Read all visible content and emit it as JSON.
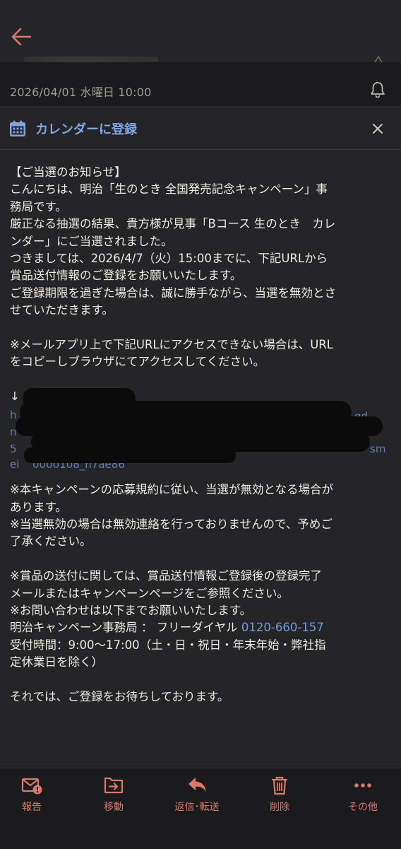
{
  "header": {
    "date": "2026/04/01 水曜日 10:00"
  },
  "calendar_bar": {
    "label": "カレンダーに登録"
  },
  "email": {
    "lines": [
      "【ご当選のお知らせ】",
      "こんにちは、明治「生のとき 全国発売記念キャンペーン」事",
      "務局です。",
      "厳正なる抽選の結果、貴方様が見事「Bコース 生のとき　カレ",
      "ンダー」にご当選されました。",
      "つきましては、2026/4/7（火）15:00までに、下記URLから",
      "賞品送付情報のご登録をお願いいたします。",
      "ご登録期限を過ぎた場合は、誠に勝手ながら、当選を無効とさ",
      "せていただきます。"
    ],
    "notice_lines": [
      "※メールアプリ上で下記URLにアクセスできない場合は、URL",
      "をコピーしブラウザにてアクセスしてください。"
    ],
    "arrow": "↓",
    "url_fragments": [
      "h",
      "qd-",
      "n",
      "5",
      "sm",
      "ei",
      "0000108_h7ae86"
    ],
    "rules_lines": [
      "※本キャンペーンの応募規約に従い、当選が無効となる場合が",
      "あります。",
      "※当選無効の場合は無効連絡を行っておりませんので、予めご",
      "了承ください。"
    ],
    "shipping_lines": [
      "※賞品の送付に関しては、賞品送付情報ご登録後の登録完了",
      "メールまたはキャンペーンページをご参照ください。",
      "※お問い合わせは以下までお願いいたします。"
    ],
    "contact_prefix": "明治キャンペーン事務局 ： フリーダイヤル ",
    "phone": "0120-660-157",
    "hours_lines": [
      "受付時間：9:00～17:00（土・日・祝日・年末年始・弊社指",
      "定休業日を除く）"
    ],
    "closing": "それでは、ご登録をお待ちしております。"
  },
  "toolbar": {
    "report": "報告",
    "move": "移動",
    "reply": "返信･転送",
    "delete": "削除",
    "more": "その他"
  },
  "colors": {
    "accent": "#d9786b",
    "link": "#6f9ce0",
    "background": "#252427"
  },
  "icons": [
    "back-arrow-icon",
    "star-icon",
    "bell-icon",
    "calendar-icon",
    "close-icon",
    "report-icon",
    "move-icon",
    "reply-icon",
    "trash-icon",
    "more-icon"
  ]
}
